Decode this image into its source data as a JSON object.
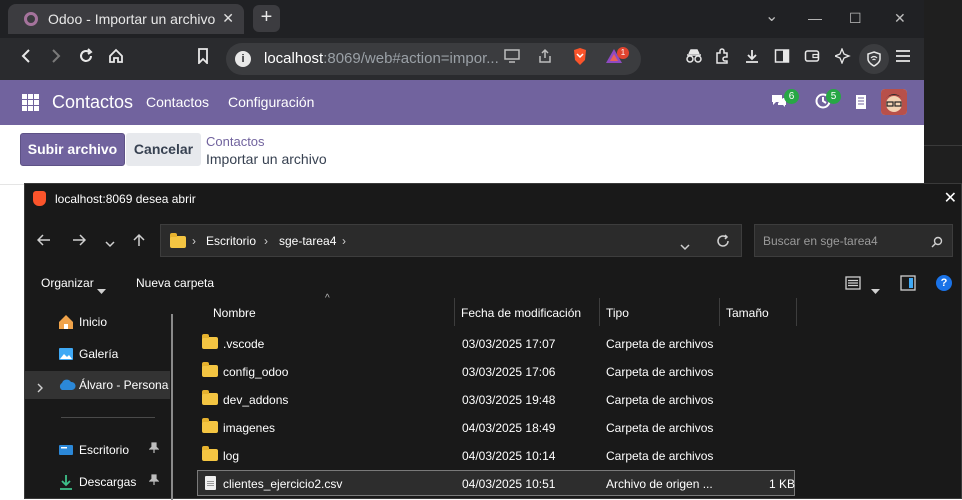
{
  "browser": {
    "tab_title": "Odoo - Importar un archivo",
    "tab_close": "✕",
    "new_tab": "+",
    "url_host": "localhost",
    "url_rest": ":8069/web#action=impor...",
    "brave_badge": "1",
    "window_controls": {
      "dropdown": "⌄",
      "minimize": "—",
      "maximize": "☐",
      "close": "✕"
    }
  },
  "odoo": {
    "app_name": "Contactos",
    "nav": [
      "Contactos",
      "Configuración"
    ],
    "messages_count": "6",
    "activities_count": "5",
    "accent_color": "#71639e"
  },
  "control_panel": {
    "upload_label": "Subir archivo",
    "cancel_label": "Cancelar",
    "breadcrumb_parent": "Contactos",
    "breadcrumb_current": "Importar un archivo"
  },
  "dialog": {
    "title": "localhost:8069 desea abrir",
    "path": [
      "Escritorio",
      "sge-tarea4"
    ],
    "search_placeholder": "Buscar en sge-tarea4",
    "organize_label": "Organizar",
    "new_folder_label": "Nueva carpeta",
    "sidebar": [
      {
        "label": "Inicio",
        "icon": "home-icon",
        "pinned": false
      },
      {
        "label": "Galería",
        "icon": "gallery-icon",
        "pinned": false
      },
      {
        "label": "Álvaro - Persona",
        "icon": "onedrive-cloud-icon",
        "pinned": false
      },
      {
        "label": "Escritorio",
        "icon": "desktop-icon",
        "pinned": true
      },
      {
        "label": "Descargas",
        "icon": "download-icon",
        "pinned": true
      }
    ],
    "columns": {
      "name": "Nombre",
      "modified": "Fecha de modificación",
      "type": "Tipo",
      "size": "Tamaño"
    },
    "files": [
      {
        "name": ".vscode",
        "modified": "03/03/2025 17:07",
        "type": "Carpeta de archivos",
        "size": "",
        "kind": "folder"
      },
      {
        "name": "config_odoo",
        "modified": "03/03/2025 17:06",
        "type": "Carpeta de archivos",
        "size": "",
        "kind": "folder"
      },
      {
        "name": "dev_addons",
        "modified": "03/03/2025 19:48",
        "type": "Carpeta de archivos",
        "size": "",
        "kind": "folder"
      },
      {
        "name": "imagenes",
        "modified": "04/03/2025 18:49",
        "type": "Carpeta de archivos",
        "size": "",
        "kind": "folder"
      },
      {
        "name": "log",
        "modified": "04/03/2025 10:14",
        "type": "Carpeta de archivos",
        "size": "",
        "kind": "folder"
      },
      {
        "name": "clientes_ejercicio2.csv",
        "modified": "04/03/2025 10:51",
        "type": "Archivo de origen ...",
        "size": "1 KB",
        "kind": "file"
      }
    ]
  }
}
